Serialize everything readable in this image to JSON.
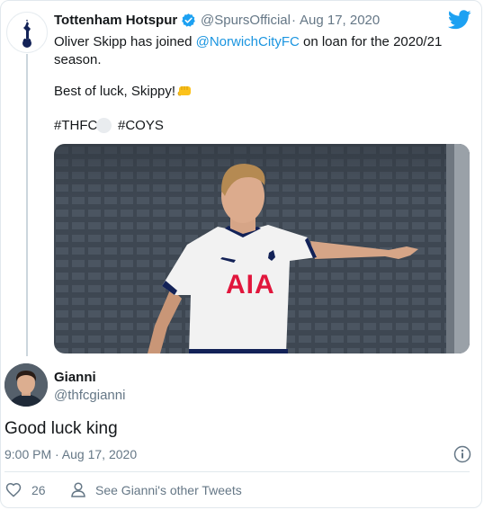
{
  "parent_tweet": {
    "author_name": "Tottenham Hotspur",
    "handle": "@SpursOfficial",
    "separator": "·",
    "date": "Aug 17, 2020",
    "text_line1_prefix": "Oliver Skipp has joined ",
    "mention": "@NorwichCityFC",
    "text_line1_suffix": " on loan for the 2020/21",
    "text_line2": "season.",
    "text_line3": "Best of luck, Skippy! ",
    "emoji": "👊",
    "hashtag1": "#THFC",
    "hashtag2": "#COYS"
  },
  "reply_tweet": {
    "author_name": "Gianni",
    "handle": "@thfcgianni",
    "text": "Good luck king",
    "timestamp": "9:00 PM · Aug 17, 2020",
    "like_count": "26",
    "see_more_label": "See Gianni's other Tweets"
  },
  "image": {
    "jersey_sponsor": "AIA"
  },
  "colors": {
    "brand_blue": "#1da1f2",
    "link_blue": "#1b95e0",
    "muted_gray": "#657786",
    "divider": "#e1e8ed"
  },
  "icons": {
    "twitter": "twitter-bird-icon",
    "verified": "verified-badge-icon",
    "info": "info-icon",
    "heart": "heart-icon",
    "profile": "profile-icon"
  }
}
